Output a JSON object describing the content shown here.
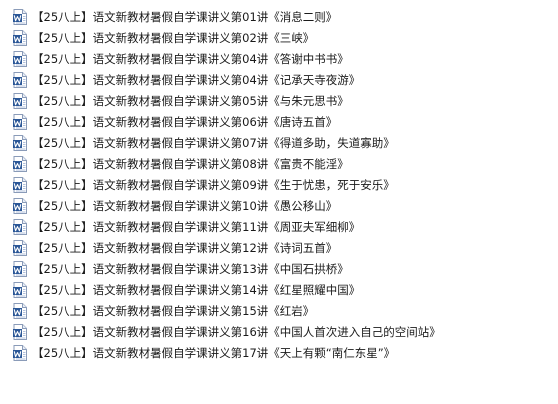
{
  "icon": {
    "name": "word-document-icon",
    "color": "#2b5797",
    "letter": "W"
  },
  "files": [
    {
      "name": "【25八上】语文新教材暑假自学课讲义第01讲《消息二则》"
    },
    {
      "name": "【25八上】语文新教材暑假自学课讲义第02讲《三峡》"
    },
    {
      "name": "【25八上】语文新教材暑假自学课讲义第04讲《答谢中书书》"
    },
    {
      "name": "【25八上】语文新教材暑假自学课讲义第04讲《记承天寺夜游》"
    },
    {
      "name": "【25八上】语文新教材暑假自学课讲义第05讲《与朱元思书》"
    },
    {
      "name": "【25八上】语文新教材暑假自学课讲义第06讲《唐诗五首》"
    },
    {
      "name": "【25八上】语文新教材暑假自学课讲义第07讲《得道多助，失道寡助》"
    },
    {
      "name": "【25八上】语文新教材暑假自学课讲义第08讲《富贵不能淫》"
    },
    {
      "name": "【25八上】语文新教材暑假自学课讲义第09讲《生于忧患，死于安乐》"
    },
    {
      "name": "【25八上】语文新教材暑假自学课讲义第10讲《愚公移山》"
    },
    {
      "name": "【25八上】语文新教材暑假自学课讲义第11讲《周亚夫军细柳》"
    },
    {
      "name": "【25八上】语文新教材暑假自学课讲义第12讲《诗词五首》"
    },
    {
      "name": "【25八上】语文新教材暑假自学课讲义第13讲《中国石拱桥》"
    },
    {
      "name": "【25八上】语文新教材暑假自学课讲义第14讲《红星照耀中国》"
    },
    {
      "name": "【25八上】语文新教材暑假自学课讲义第15讲《红岩》"
    },
    {
      "name": "【25八上】语文新教材暑假自学课讲义第16讲《中国人首次进入自己的空间站》"
    },
    {
      "name": "【25八上】语文新教材暑假自学课讲义第17讲《天上有颗“南仁东星”》"
    }
  ]
}
